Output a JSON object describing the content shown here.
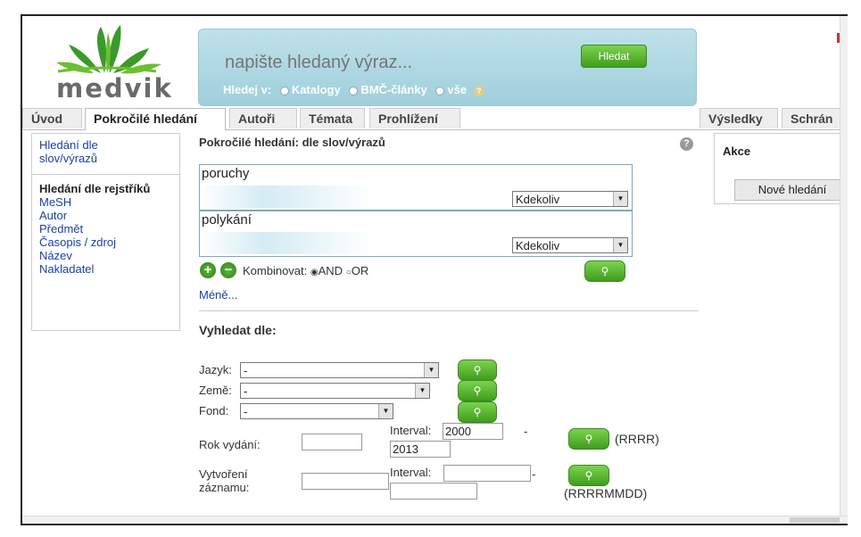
{
  "header": {
    "logo_text": "medvik",
    "search_placeholder": "napište hledaný výraz...",
    "search_button": "Hledat",
    "scope_label": "Hledej v:",
    "scope_options": [
      "Katalogy",
      "BMČ-články",
      "vše"
    ]
  },
  "tabs": [
    "Úvod",
    "Pokročilé hledání",
    "Autoři",
    "Témata",
    "Prohlížení"
  ],
  "right_tabs": [
    "Výsledky",
    "Schrán"
  ],
  "sidebar": {
    "top_link": "Hledání dle slov/výrazů",
    "title": "Hledání dle rejstříků",
    "links": [
      "MeSH",
      "Autor",
      "Předmět",
      "Časopis / zdroj",
      "Název",
      "Nakladatel"
    ]
  },
  "main": {
    "title": "Pokročilé hledání: dle slov/výrazů",
    "terms": [
      {
        "value": "poruchy",
        "field": "Kdekoliv"
      },
      {
        "value": "polykání",
        "field": "Kdekoliv"
      }
    ],
    "combine_label": "Kombinovat:",
    "combine_options": [
      "AND",
      "OR"
    ],
    "less_link": "Méně...",
    "filter_title": "Vyhledat dle:",
    "filters": [
      {
        "label": "Jazyk:",
        "value": "-"
      },
      {
        "label": "Země:",
        "value": "-"
      },
      {
        "label": "Fond:",
        "value": "-"
      }
    ],
    "year_label": "Rok vydání:",
    "interval_label": "Interval:",
    "year_from": "2000",
    "year_to": "2013",
    "year_hint": "(RRRR)",
    "created_label": "Vytvoření záznamu:",
    "created_hint": "(RRRRMMDD)",
    "dash": "-"
  },
  "actions": {
    "title": "Akce",
    "new_search": "Nové hledání"
  },
  "colors": {
    "accent_green": "#3f9d1d",
    "search_panel": "#aad6e2",
    "link": "#1a3fa6"
  }
}
